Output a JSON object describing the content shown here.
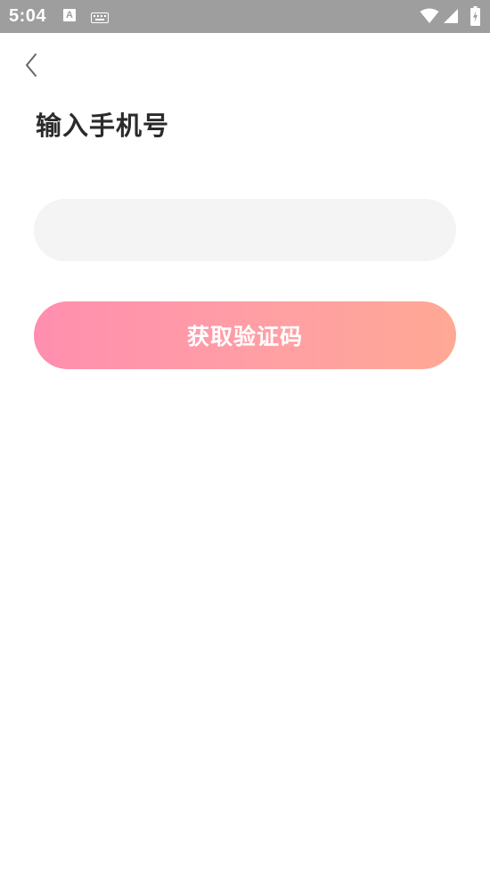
{
  "status_bar": {
    "time": "5:04",
    "notification_a": "A",
    "icons": [
      "text-notification-icon",
      "keyboard-icon",
      "wifi-icon",
      "cell-signal-icon",
      "battery-charging-icon"
    ]
  },
  "nav": {
    "back_icon": "chevron-left-icon"
  },
  "page": {
    "title": "输入手机号"
  },
  "phone_input": {
    "value": "",
    "placeholder": ""
  },
  "get_code_button": {
    "label": "获取验证码"
  },
  "colors": {
    "status_bar": "#9e9e9e",
    "input_bg": "#f4f4f4",
    "button_gradient_start": "#ff8eaf",
    "button_gradient_end": "#ffa894",
    "title_text": "#2b2b2b"
  }
}
